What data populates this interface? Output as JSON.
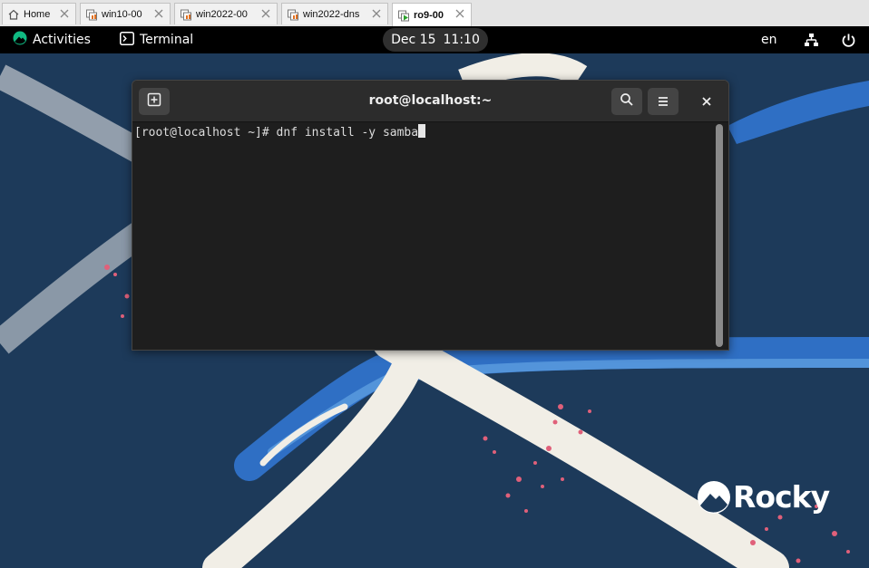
{
  "vm_tabs": [
    {
      "label": "Home",
      "icon": "home-icon",
      "active": false
    },
    {
      "label": "win10-00",
      "icon": "vm-icon",
      "active": false
    },
    {
      "label": "win2022-00",
      "icon": "vm-icon",
      "active": false
    },
    {
      "label": "win2022-dns",
      "icon": "vm-icon",
      "active": false
    },
    {
      "label": "ro9-00",
      "icon": "vm-running-icon",
      "active": true
    }
  ],
  "topbar": {
    "activities_label": "Activities",
    "app_label": "Terminal",
    "clock_date": "Dec 15",
    "clock_time": "11:10",
    "language": "en"
  },
  "terminal": {
    "title": "root@localhost:~",
    "prompt": "[root@localhost ~]# ",
    "command": "dnf install -y samba"
  },
  "desktop": {
    "logo_text": "Rocky"
  },
  "colors": {
    "wallpaper": "#1d3a5a",
    "terminal_bg": "#1e1e1e",
    "header_bg": "#2c2c2c",
    "rocky_green": "#10b981"
  }
}
